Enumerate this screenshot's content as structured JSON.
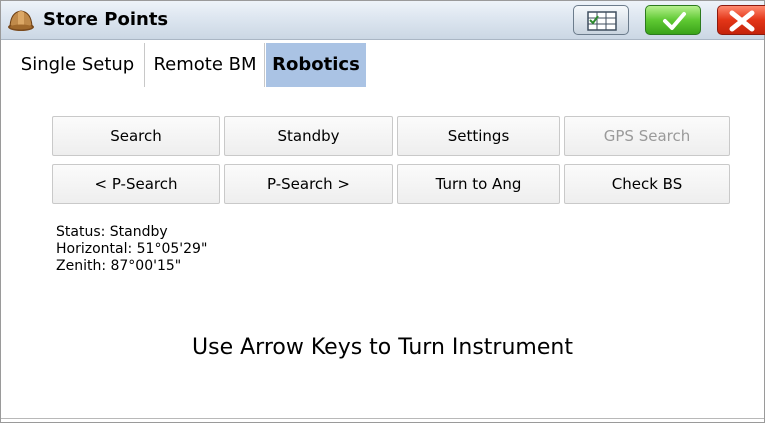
{
  "window": {
    "title": "Store Points",
    "icon": "hard-hat-icon"
  },
  "titlebar_buttons": [
    {
      "name": "table-icon",
      "color": "#c9d4df"
    },
    {
      "name": "check-icon",
      "color": "#3aa319"
    },
    {
      "name": "close-icon",
      "color": "#e33517"
    }
  ],
  "tabs": [
    {
      "label": "Single Setup",
      "active": false
    },
    {
      "label": "Remote BM",
      "active": false
    },
    {
      "label": "Robotics",
      "active": true
    }
  ],
  "buttons": {
    "row1": [
      {
        "label": "Search",
        "enabled": true
      },
      {
        "label": "Standby",
        "enabled": true
      },
      {
        "label": "Settings",
        "enabled": true
      },
      {
        "label": "GPS Search",
        "enabled": false
      }
    ],
    "row2": [
      {
        "label": "< P-Search",
        "enabled": true
      },
      {
        "label": "P-Search >",
        "enabled": true
      },
      {
        "label": "Turn to Ang",
        "enabled": true
      },
      {
        "label": "Check BS",
        "enabled": true
      }
    ]
  },
  "status": {
    "status_line": "Status: Standby",
    "horizontal_line": "Horizontal: 51°05'29\"",
    "zenith_line": "Zenith: 87°00'15\""
  },
  "hint": "Use Arrow Keys to Turn Instrument",
  "colors": {
    "active_tab": "#aac3e4",
    "titlebar": "#dde6f0"
  }
}
